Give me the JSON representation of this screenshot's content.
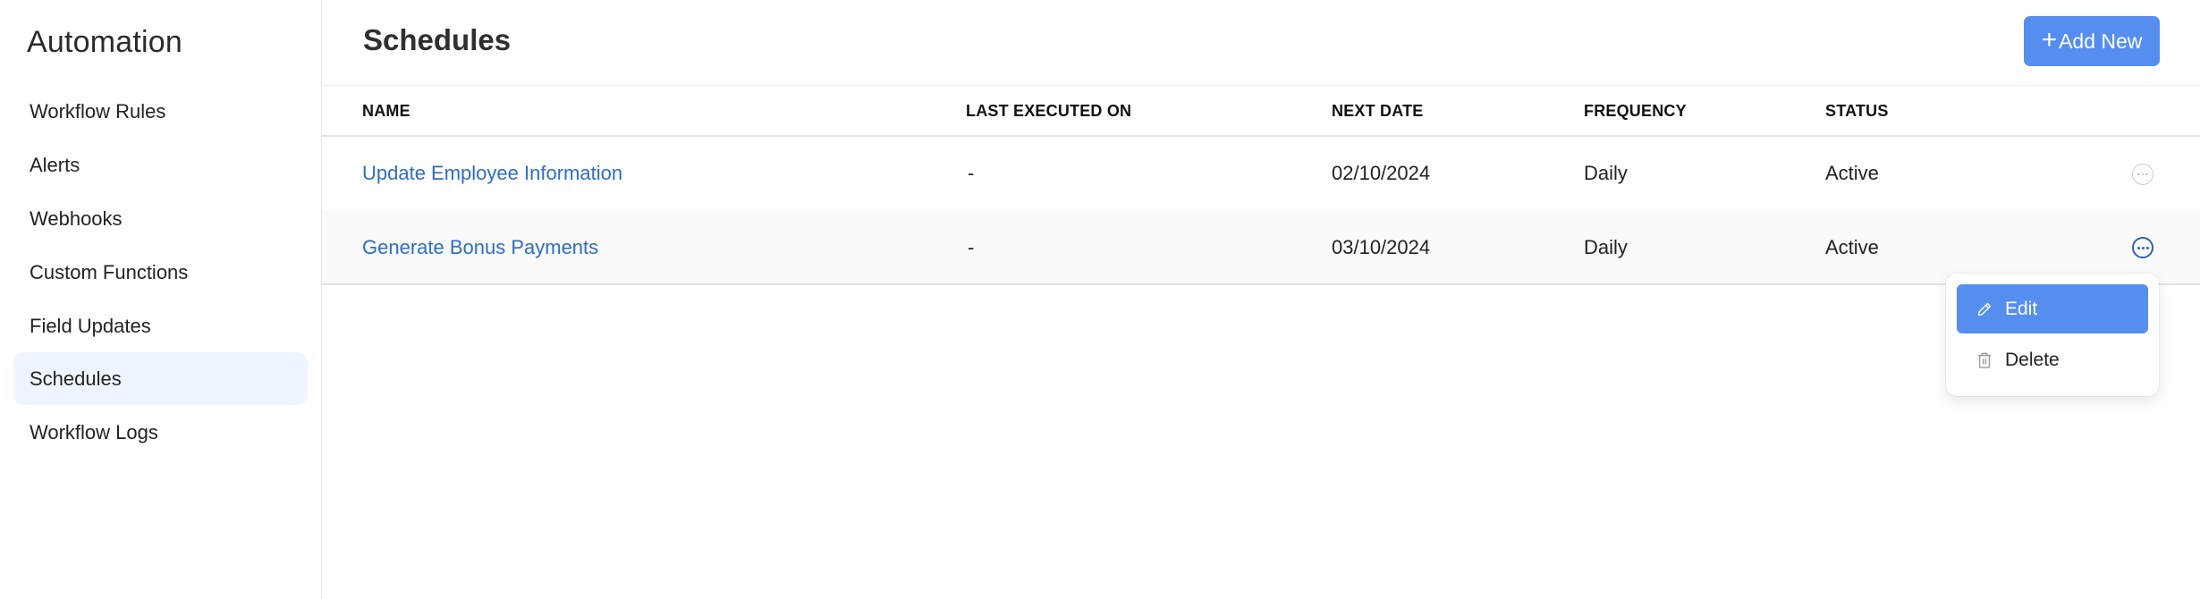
{
  "sidebar": {
    "title": "Automation",
    "items": [
      {
        "label": "Workflow Rules",
        "active": false
      },
      {
        "label": "Alerts",
        "active": false
      },
      {
        "label": "Webhooks",
        "active": false
      },
      {
        "label": "Custom Functions",
        "active": false
      },
      {
        "label": "Field Updates",
        "active": false
      },
      {
        "label": "Schedules",
        "active": true
      },
      {
        "label": "Workflow Logs",
        "active": false
      }
    ]
  },
  "header": {
    "title": "Schedules",
    "add_button": {
      "icon": "plus-icon",
      "label": "Add New"
    }
  },
  "table": {
    "columns": [
      "NAME",
      "LAST EXECUTED ON",
      "NEXT DATE",
      "FREQUENCY",
      "STATUS"
    ],
    "rows": [
      {
        "name": "Update Employee Information",
        "last_executed_on": "-",
        "next_date": "02/10/2024",
        "frequency": "Daily",
        "status": "Active",
        "actions_icon": "ellipsis-circle-icon"
      },
      {
        "name": "Generate Bonus Payments",
        "last_executed_on": "-",
        "next_date": "03/10/2024",
        "frequency": "Daily",
        "status": "Active",
        "actions_icon": "ellipsis-circle-icon"
      }
    ]
  },
  "row_menu": {
    "open_for_row": 1,
    "items": [
      {
        "label": "Edit",
        "icon": "pencil-icon",
        "highlighted": true
      },
      {
        "label": "Delete",
        "icon": "trash-icon",
        "highlighted": false
      }
    ]
  },
  "colors": {
    "accent": "#568ef0",
    "link": "#2f6cc4",
    "active_nav_bg": "#eff5fe",
    "active_more_icon": "#2b63b5"
  }
}
